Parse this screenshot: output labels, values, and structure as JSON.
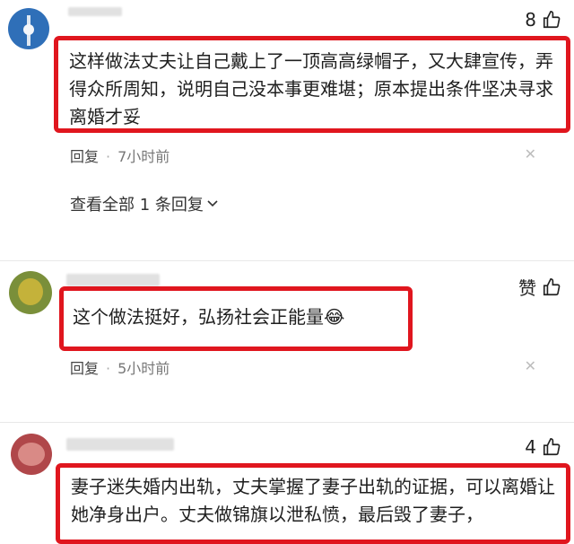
{
  "comments": [
    {
      "likes": "8",
      "text": "这样做法丈夫让自己戴上了一顶高高绿帽子，又大肆宣传，弄得众所周知，说明自己没本事更难堪；原本提出条件坚决寻求离婚才妥",
      "reply_label": "回复",
      "time": "7小时前",
      "view_all": "查看全部 1 条回复"
    },
    {
      "likes": "赞",
      "text": "这个做法挺好，弘扬社会正能量",
      "emoji": "😂",
      "reply_label": "回复",
      "time": "5小时前"
    },
    {
      "likes": "4",
      "text": "妻子迷失婚内出轨，丈夫掌握了妻子出轨的证据，可以离婚让她净身出户。丈夫做锦旗以泄私愤，最后毁了妻子，"
    }
  ],
  "icons": {
    "like": "thumbs-up-icon",
    "close": "close-icon",
    "expand": "chevron-down-icon"
  },
  "colors": {
    "highlight_border": "#e0161e",
    "meta_text": "#777777"
  }
}
